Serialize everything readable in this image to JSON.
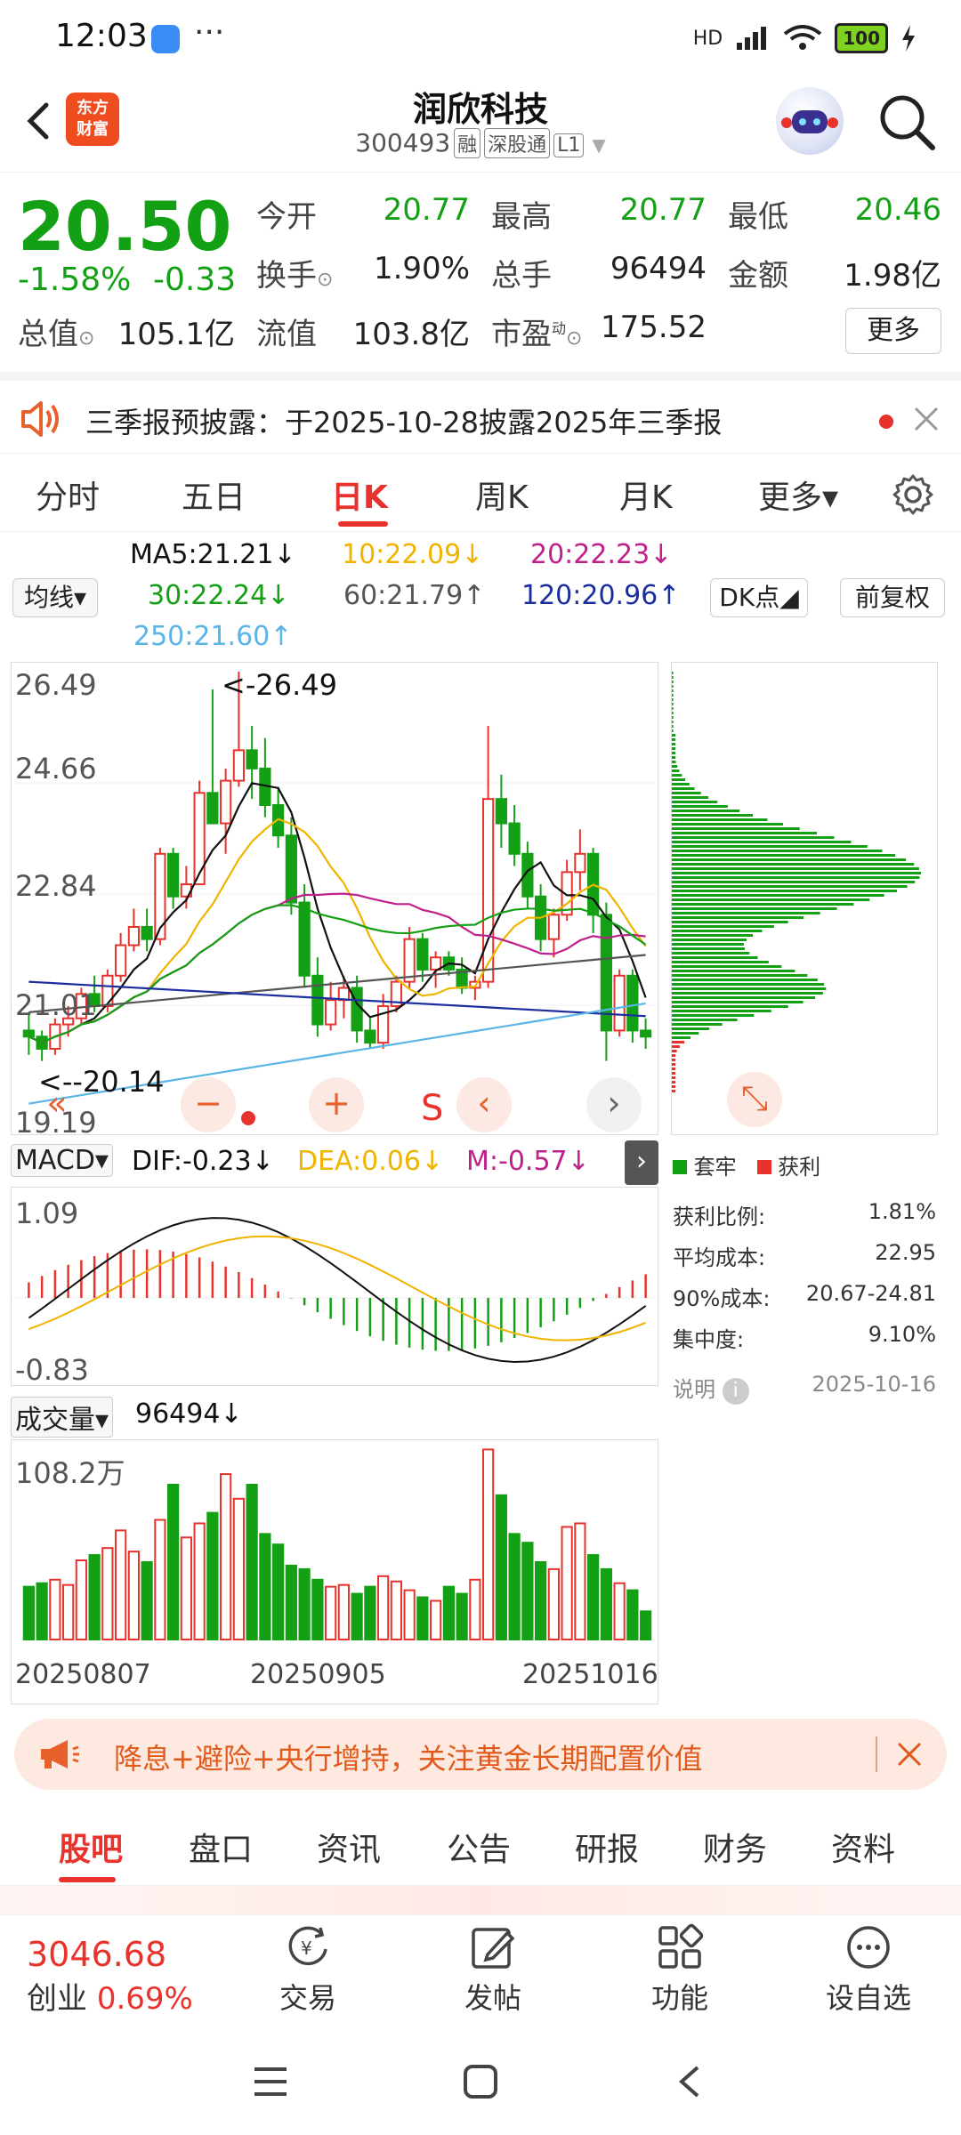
{
  "status": {
    "time": "12:03",
    "dots": "···",
    "network": "HD",
    "battery": "100"
  },
  "header": {
    "name": "润欣科技",
    "code": "300493",
    "tags": [
      "融",
      "深股通",
      "L1"
    ],
    "logo_line1": "东方",
    "logo_line2": "财富"
  },
  "quote": {
    "price": "20.50",
    "chg_pct": "-1.58%",
    "chg": "-0.33",
    "open_label": "今开",
    "open": "20.77",
    "high_label": "最高",
    "high": "20.77",
    "low_label": "最低",
    "low": "20.46",
    "turnover_label": "换手",
    "turnover": "1.90%",
    "volume_label": "总手",
    "volume": "96494",
    "amount_label": "金额",
    "amount": "1.98亿",
    "mktcap_label": "总值",
    "mktcap": "105.1亿",
    "float_label": "流值",
    "float": "103.8亿",
    "pe_label": "市盈",
    "pe_sup": "动",
    "pe": "175.52",
    "more": "更多"
  },
  "notice": {
    "text": "三季报预披露：于2025-10-28披露2025年三季报"
  },
  "tabs": [
    {
      "label": "分时"
    },
    {
      "label": "五日"
    },
    {
      "label": "日K"
    },
    {
      "label": "周K"
    },
    {
      "label": "月K"
    },
    {
      "label": "更多▾"
    }
  ],
  "ma": {
    "toggle": "均线▾",
    "ma5": "MA5:21.21↓",
    "ma10": "10:22.09↓",
    "ma20": "20:22.23↓",
    "ma30": "30:22.24↓",
    "ma60": "60:21.79↑",
    "ma120": "120:20.96↑",
    "ma250": "250:21.60↑",
    "dk": "DK点◢",
    "fq": "前复权"
  },
  "colors": {
    "up": "#e8322c",
    "down": "#14a014",
    "ma5": "#111111",
    "ma10": "#f0b400",
    "ma20": "#c0208a",
    "ma30": "#14a014",
    "ma60": "#555555",
    "ma120": "#1a2ea0",
    "ma250": "#5ab4e6"
  },
  "kline": {
    "ymax_label": "26.49",
    "y2_label": "24.66",
    "y3_label": "22.84",
    "y4_label": "21.01",
    "ymin_label": "19.19",
    "hi_mark": "<-26.49",
    "lo_mark": "<--20.14",
    "s_mark": "S"
  },
  "chart_data": {
    "type": "candlestick",
    "ylim": [
      19.19,
      26.49
    ],
    "x_ticks": [
      "20250807",
      "20250905",
      "20251016"
    ],
    "candles": [
      [
        20.6,
        20.9,
        20.2,
        20.5
      ],
      [
        20.5,
        20.6,
        20.1,
        20.3
      ],
      [
        20.3,
        20.8,
        20.2,
        20.7
      ],
      [
        20.7,
        21.0,
        20.5,
        20.8
      ],
      [
        20.8,
        21.3,
        20.7,
        21.2
      ],
      [
        21.2,
        21.5,
        20.9,
        21.0
      ],
      [
        21.0,
        21.6,
        20.9,
        21.5
      ],
      [
        21.5,
        22.2,
        21.4,
        22.0
      ],
      [
        22.0,
        22.6,
        21.9,
        22.3
      ],
      [
        22.3,
        22.6,
        21.9,
        22.1
      ],
      [
        22.1,
        23.6,
        22.0,
        23.5
      ],
      [
        23.5,
        23.6,
        22.6,
        22.8
      ],
      [
        22.8,
        23.3,
        22.6,
        23.0
      ],
      [
        23.0,
        24.7,
        23.0,
        24.5
      ],
      [
        24.5,
        26.2,
        24.0,
        24.0
      ],
      [
        24.0,
        24.9,
        23.5,
        24.7
      ],
      [
        24.7,
        26.49,
        24.6,
        25.2
      ],
      [
        25.2,
        25.6,
        24.4,
        24.9
      ],
      [
        24.9,
        25.4,
        24.1,
        24.3
      ],
      [
        24.3,
        24.6,
        23.6,
        23.8
      ],
      [
        23.8,
        24.1,
        22.5,
        22.7
      ],
      [
        22.7,
        23.0,
        21.3,
        21.5
      ],
      [
        21.5,
        21.8,
        20.5,
        20.7
      ],
      [
        20.7,
        21.4,
        20.6,
        21.1
      ],
      [
        21.1,
        21.5,
        20.8,
        21.3
      ],
      [
        21.3,
        21.5,
        20.4,
        20.6
      ],
      [
        20.6,
        20.8,
        20.3,
        20.4
      ],
      [
        20.4,
        21.2,
        20.3,
        21.0
      ],
      [
        21.0,
        21.5,
        20.9,
        21.4
      ],
      [
        21.4,
        22.3,
        21.3,
        22.1
      ],
      [
        22.1,
        22.2,
        21.4,
        21.6
      ],
      [
        21.6,
        21.9,
        21.3,
        21.8
      ],
      [
        21.8,
        21.9,
        21.5,
        21.6
      ],
      [
        21.6,
        21.8,
        21.2,
        21.3
      ],
      [
        21.3,
        21.5,
        21.1,
        21.4
      ],
      [
        21.4,
        25.6,
        21.3,
        24.4
      ],
      [
        24.4,
        24.8,
        23.6,
        24.0
      ],
      [
        24.0,
        24.3,
        23.3,
        23.5
      ],
      [
        23.5,
        23.7,
        22.6,
        22.8
      ],
      [
        22.8,
        23.0,
        21.9,
        22.1
      ],
      [
        22.1,
        22.6,
        21.8,
        22.5
      ],
      [
        22.5,
        23.4,
        22.4,
        23.2
      ],
      [
        23.2,
        23.9,
        22.9,
        23.5
      ],
      [
        23.5,
        23.6,
        22.2,
        22.5
      ],
      [
        22.5,
        22.7,
        20.1,
        20.6
      ],
      [
        20.6,
        21.6,
        20.5,
        21.5
      ],
      [
        21.5,
        21.6,
        20.4,
        20.6
      ],
      [
        20.6,
        20.8,
        20.3,
        20.5
      ]
    ],
    "volume_ymax_label": "108.2万",
    "volume": [
      30,
      32,
      34,
      31,
      45,
      48,
      52,
      62,
      50,
      44,
      68,
      88,
      58,
      66,
      72,
      94,
      80,
      88,
      60,
      54,
      42,
      40,
      34,
      30,
      31,
      26,
      30,
      36,
      33,
      28,
      24,
      22,
      30,
      26,
      34,
      108,
      82,
      60,
      55,
      44,
      40,
      64,
      66,
      48,
      40,
      32,
      28,
      16
    ],
    "macd_ymax_label": "1.09",
    "macd_ymin_label": "-0.83"
  },
  "macd": {
    "toggle": "MACD▾",
    "dif": "DIF:-0.23↓",
    "dea": "DEA:0.06↓",
    "m": "M:-0.57↓"
  },
  "vol": {
    "toggle": "成交量▾",
    "value": "96494↓"
  },
  "chips": {
    "legend_trapped": "套牢",
    "legend_profit": "获利",
    "rows": [
      {
        "label": "获利比例:",
        "value": "1.81%"
      },
      {
        "label": "平均成本:",
        "value": "22.95"
      },
      {
        "label": "90%成本:",
        "value": "20.67-24.81"
      },
      {
        "label": "集中度:",
        "value": "9.10%"
      }
    ],
    "note": "说明",
    "date": "2025-10-16"
  },
  "banner": {
    "text": "降息+避险+央行增持，关注黄金长期配置价值"
  },
  "bottom_tabs": [
    {
      "label": "股吧"
    },
    {
      "label": "盘口"
    },
    {
      "label": "资讯"
    },
    {
      "label": "公告"
    },
    {
      "label": "研报"
    },
    {
      "label": "财务"
    },
    {
      "label": "资料"
    }
  ],
  "index": {
    "value": "3046.68",
    "name": "创业",
    "pct": "0.69%"
  },
  "toolbar": [
    {
      "label": "交易"
    },
    {
      "label": "发帖"
    },
    {
      "label": "功能"
    },
    {
      "label": "设自选"
    }
  ]
}
